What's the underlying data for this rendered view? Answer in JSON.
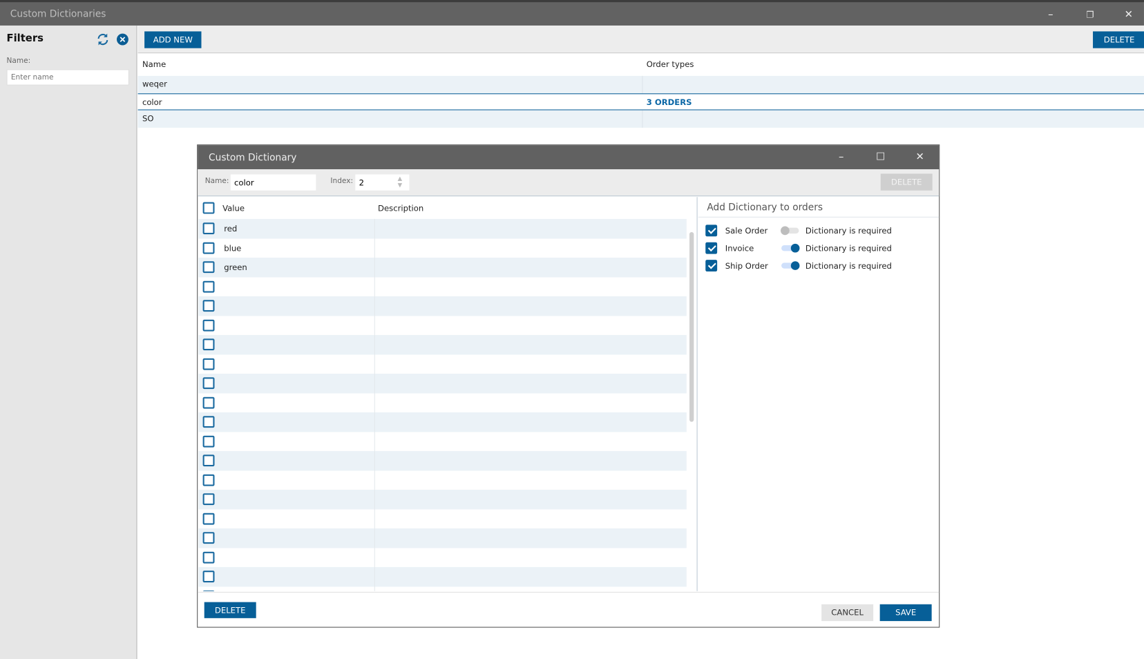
{
  "window": {
    "title": "Custom Dictionaries",
    "minimize": "–",
    "restore": "❐",
    "close": "✕"
  },
  "filters": {
    "title": "Filters",
    "name_label": "Name:",
    "name_placeholder": "Enter name"
  },
  "toolbar": {
    "add_new": "ADD NEW",
    "delete": "DELETE"
  },
  "grid": {
    "headers": [
      "Name",
      "Order types"
    ],
    "rows": [
      {
        "name": "weqer",
        "orders": ""
      },
      {
        "name": "color",
        "orders": "3 ORDERS"
      },
      {
        "name": "SO",
        "orders": ""
      }
    ]
  },
  "dialog": {
    "title": "Custom Dictionary",
    "minimize": "–",
    "maximize": "☐",
    "close": "✕",
    "name_label": "Name:",
    "name_value": "color",
    "index_label": "Index:",
    "index_value": "2",
    "delete_top": "DELETE",
    "list_headers": [
      "Value",
      "Description"
    ],
    "values": [
      "red",
      "blue",
      "green",
      "",
      "",
      "",
      "",
      "",
      "",
      "",
      "",
      "",
      "",
      "",
      "",
      "",
      "",
      "",
      "",
      ""
    ],
    "orders_title": "Add Dictionary to orders",
    "orders": [
      {
        "name": "Sale Order",
        "checked": true,
        "required": false,
        "required_label": "Dictionary is required"
      },
      {
        "name": "Invoice",
        "checked": true,
        "required": true,
        "required_label": "Dictionary is required"
      },
      {
        "name": "Ship Order",
        "checked": true,
        "required": true,
        "required_label": "Dictionary is required"
      }
    ],
    "delete_bottom": "DELETE",
    "cancel": "CANCEL",
    "save": "SAVE"
  },
  "colors": {
    "accent": "#075f98",
    "titlebar": "#626262"
  }
}
